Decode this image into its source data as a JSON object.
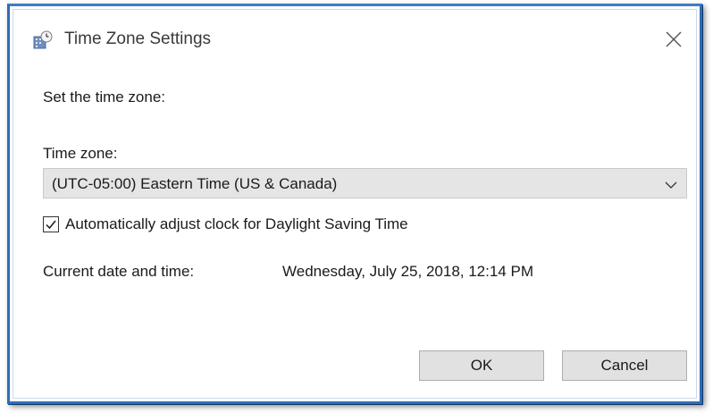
{
  "window": {
    "title": "Time Zone Settings",
    "title_icon": "clock-globe-icon",
    "close_icon": "close-icon"
  },
  "main": {
    "prompt": "Set the time zone:",
    "time_zone_label": "Time zone:",
    "time_zone_value": "(UTC-05:00) Eastern Time (US & Canada)",
    "dst_checkbox_label": "Automatically adjust clock for Daylight Saving Time",
    "dst_checked": true,
    "current_datetime_label": "Current date and time:",
    "current_datetime_value": "Wednesday, July 25, 2018, 12:14 PM"
  },
  "buttons": {
    "ok": "OK",
    "cancel": "Cancel"
  },
  "colors": {
    "frame_border": "#2f6db7",
    "button_bg": "#e1e1e1",
    "select_bg": "#e5e5e5"
  }
}
